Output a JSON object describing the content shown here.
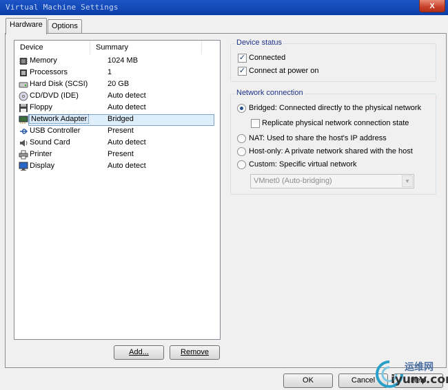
{
  "window": {
    "title": "Virtual Machine Settings",
    "close_glyph": "X"
  },
  "tabs": [
    {
      "label": "Hardware",
      "active": true
    },
    {
      "label": "Options",
      "active": false
    }
  ],
  "device_list": {
    "headers": {
      "device": "Device",
      "summary": "Summary"
    },
    "rows": [
      {
        "name": "Memory",
        "summary": "1024 MB",
        "icon": "memory-icon"
      },
      {
        "name": "Processors",
        "summary": "1",
        "icon": "processor-icon"
      },
      {
        "name": "Hard Disk (SCSI)",
        "summary": "20 GB",
        "icon": "hard-disk-icon"
      },
      {
        "name": "CD/DVD (IDE)",
        "summary": "Auto detect",
        "icon": "cd-dvd-icon"
      },
      {
        "name": "Floppy",
        "summary": "Auto detect",
        "icon": "floppy-icon"
      },
      {
        "name": "Network Adapter",
        "summary": "Bridged",
        "icon": "network-adapter-icon",
        "selected": true
      },
      {
        "name": "USB Controller",
        "summary": "Present",
        "icon": "usb-icon"
      },
      {
        "name": "Sound Card",
        "summary": "Auto detect",
        "icon": "sound-card-icon"
      },
      {
        "name": "Printer",
        "summary": "Present",
        "icon": "printer-icon"
      },
      {
        "name": "Display",
        "summary": "Auto detect",
        "icon": "display-icon"
      }
    ]
  },
  "list_buttons": {
    "add": "Add...",
    "remove": "Remove"
  },
  "device_status": {
    "legend": "Device status",
    "connected": {
      "label": "Connected",
      "checked": true
    },
    "connect_at_power_on": {
      "label": "Connect at power on",
      "checked": true
    }
  },
  "network_connection": {
    "legend": "Network connection",
    "bridged": {
      "label": "Bridged: Connected directly to the physical network",
      "selected": true
    },
    "replicate": {
      "label": "Replicate physical network connection state",
      "checked": false
    },
    "nat": {
      "label": "NAT: Used to share the host's IP address",
      "selected": false
    },
    "host_only": {
      "label": "Host-only: A private network shared with the host",
      "selected": false
    },
    "custom": {
      "label": "Custom: Specific virtual network",
      "selected": false
    },
    "vmnet_select": {
      "value": "VMnet0 (Auto-bridging)",
      "enabled": false
    }
  },
  "dialog_buttons": {
    "ok": "OK",
    "cancel": "Cancel",
    "help": "Help"
  },
  "watermark": {
    "cn": "运维网",
    "en": "iyunv.com"
  }
}
